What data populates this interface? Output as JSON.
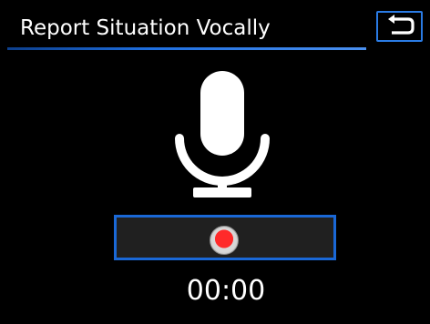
{
  "header": {
    "title": "Report Situation Vocally"
  },
  "icons": {
    "back": "back-arrow-icon",
    "microphone": "microphone-icon",
    "record": "record-dot-icon"
  },
  "recorder": {
    "elapsed": "00:00"
  },
  "colors": {
    "background": "#000000",
    "accent_blue": "#1a68d6",
    "record_red": "#ff2a2a",
    "text": "#ffffff"
  }
}
